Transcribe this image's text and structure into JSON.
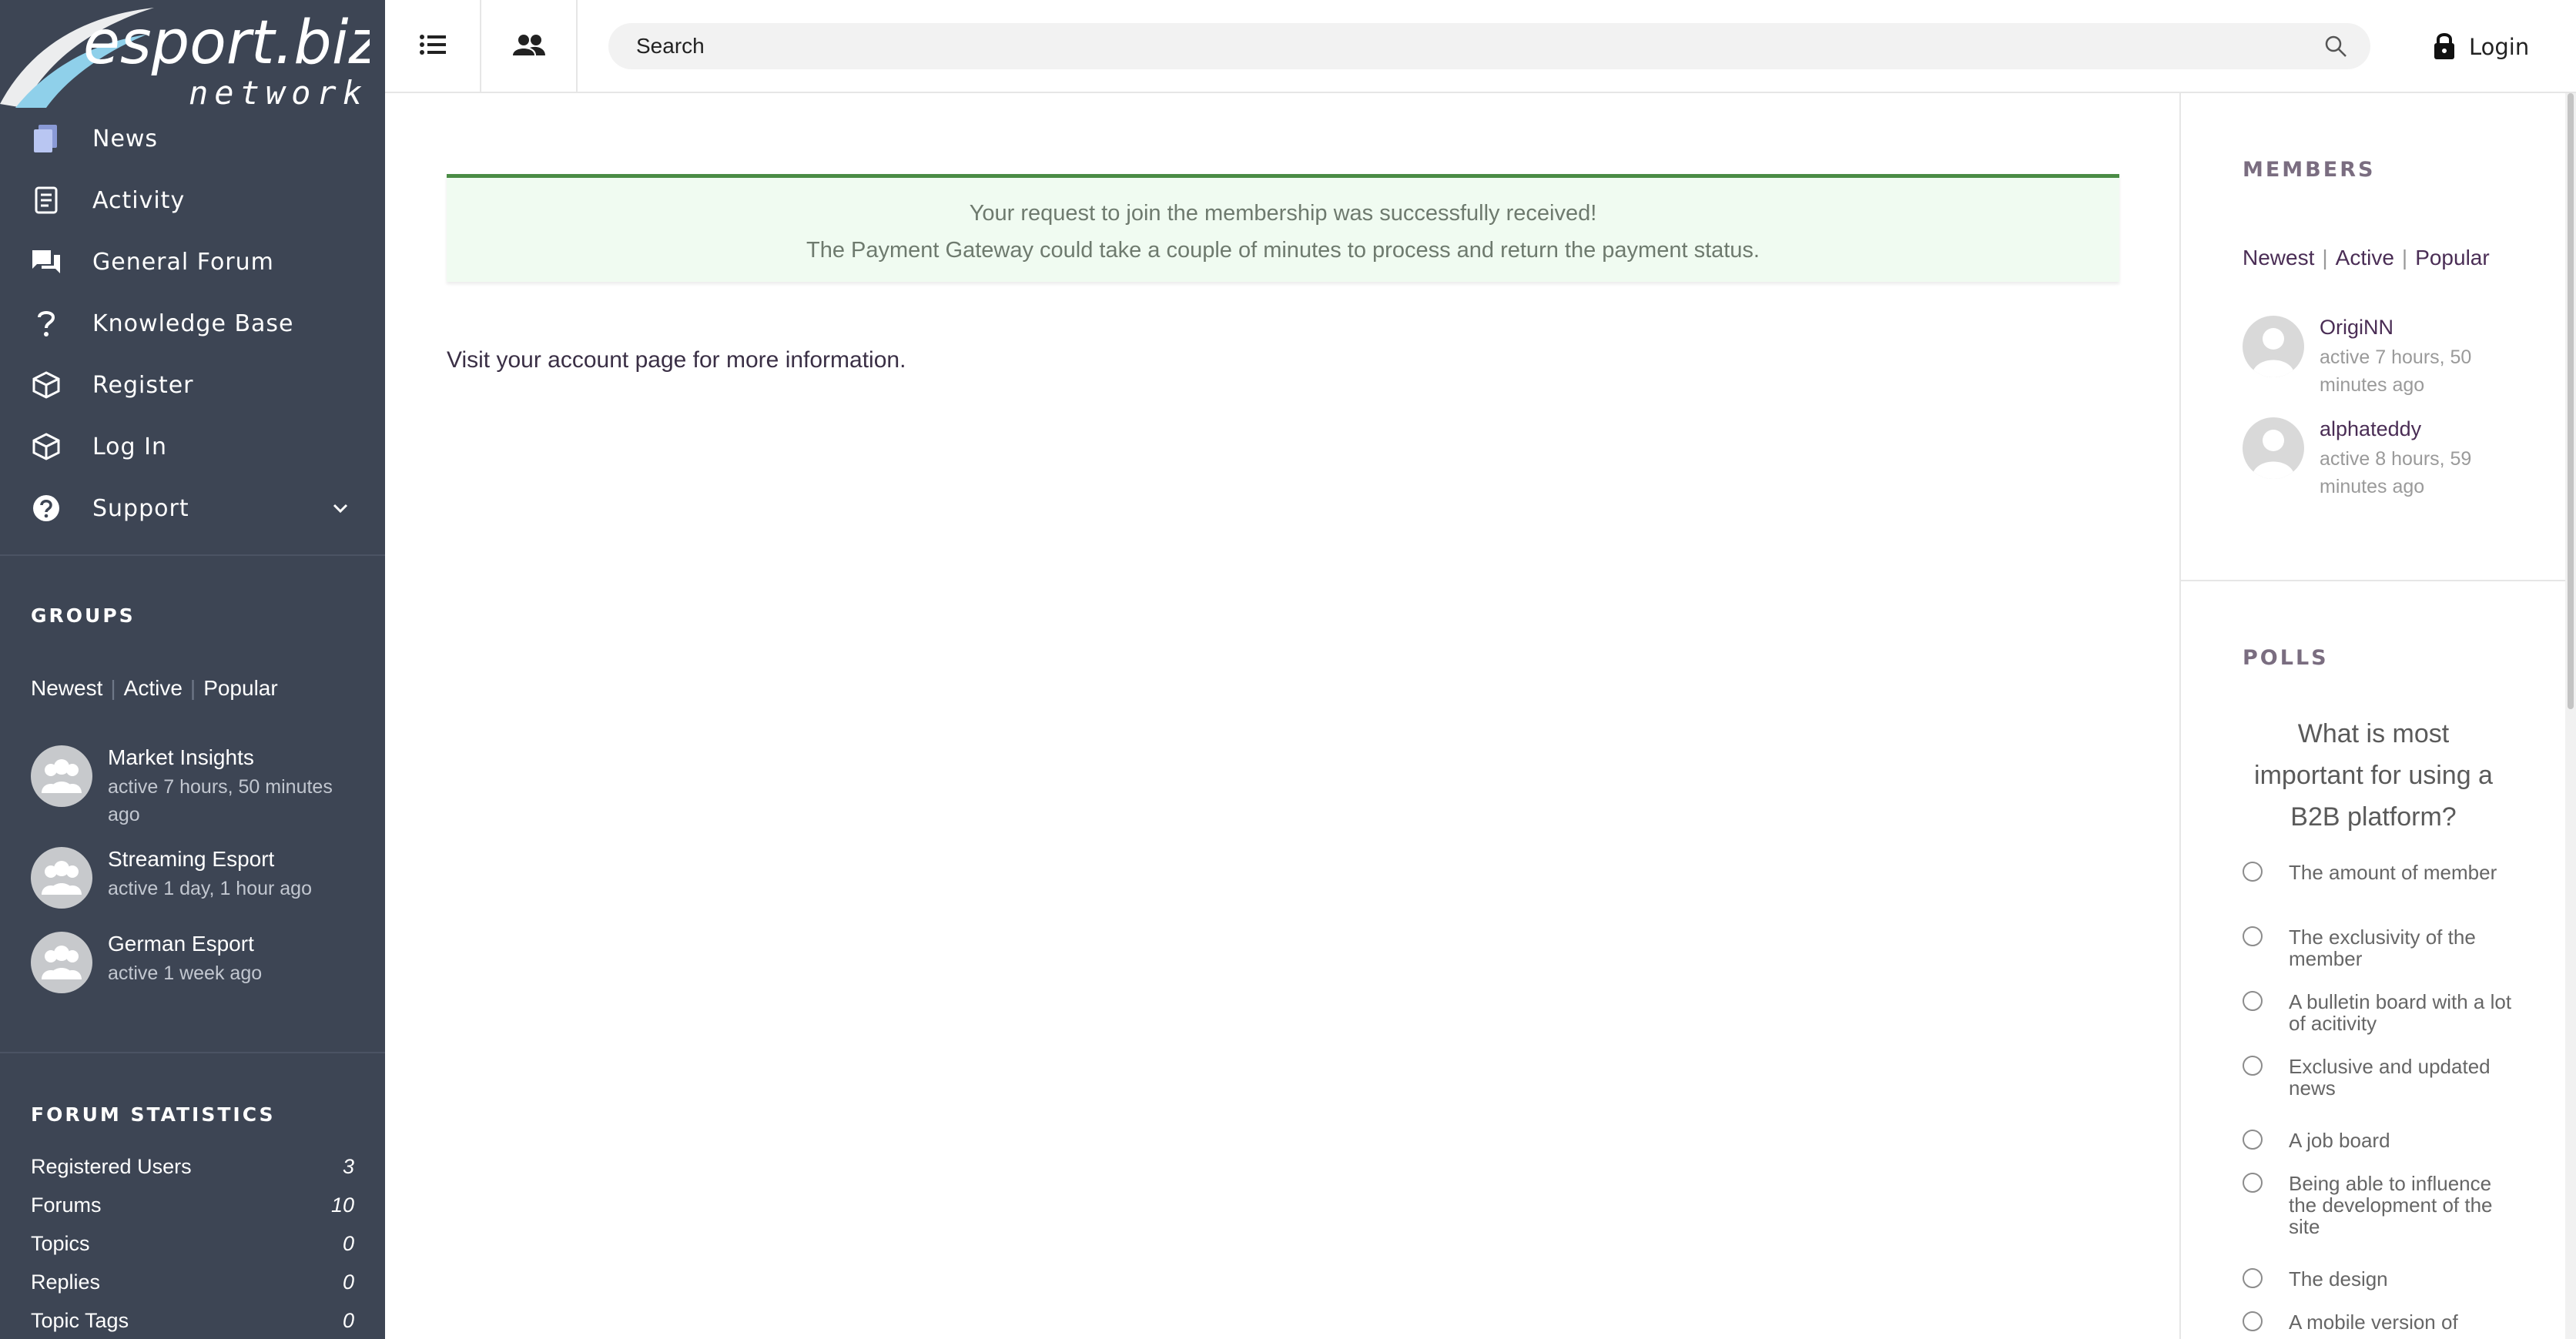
{
  "brand": {
    "logo_text_main": "esport.biz",
    "logo_text_sub": "network"
  },
  "sidebar": {
    "nav": [
      {
        "label": "News",
        "icon": "news-icon"
      },
      {
        "label": "Activity",
        "icon": "activity-icon"
      },
      {
        "label": "General Forum",
        "icon": "forum-icon"
      },
      {
        "label": "Knowledge Base",
        "icon": "question-icon"
      },
      {
        "label": "Register",
        "icon": "cube-icon"
      },
      {
        "label": "Log In",
        "icon": "cube-icon"
      },
      {
        "label": "Support",
        "icon": "help-circle-icon"
      }
    ],
    "groups": {
      "heading": "GROUPS",
      "tabs": [
        "Newest",
        "Active",
        "Popular"
      ],
      "items": [
        {
          "name": "Market Insights",
          "meta": "active 7 hours, 50 minutes ago"
        },
        {
          "name": "Streaming Esport",
          "meta": "active 1 day, 1 hour ago"
        },
        {
          "name": "German Esport",
          "meta": "active 1 week ago"
        }
      ]
    },
    "forum_stats": {
      "heading": "FORUM STATISTICS",
      "rows": [
        {
          "label": "Registered Users",
          "value": "3"
        },
        {
          "label": "Forums",
          "value": "10"
        },
        {
          "label": "Topics",
          "value": "0"
        },
        {
          "label": "Replies",
          "value": "0"
        },
        {
          "label": "Topic Tags",
          "value": "0"
        }
      ]
    }
  },
  "topbar": {
    "search_placeholder": "Search",
    "login_label": "Login"
  },
  "main": {
    "notice_line1": "Your request to join the membership was successfully received!",
    "notice_line2": "The Payment Gateway could take a couple of minutes to process and return the payment status.",
    "info_prefix": "Visit your ",
    "info_link": "account page",
    "info_suffix": " for more information."
  },
  "rightbar": {
    "members": {
      "heading": "MEMBERS",
      "tabs": [
        "Newest",
        "Active",
        "Popular"
      ],
      "items": [
        {
          "name": "OrigiNN",
          "meta": "active 7 hours, 50 minutes ago"
        },
        {
          "name": "alphateddy",
          "meta": "active 8 hours, 59 minutes ago"
        }
      ]
    },
    "polls": {
      "heading": "POLLS",
      "question": "What is most important for using a B2B platform?",
      "options": [
        "The amount of member",
        "The exclusivity of the member",
        "A bulletin board with a lot of acitivity",
        "Exclusive and updated news",
        "A job board",
        "Being able to influence the development of the site",
        "The design",
        "A mobile version of"
      ]
    }
  },
  "colors": {
    "sidebar_bg": "#3d4554",
    "notice_border": "#4a8c45",
    "notice_bg": "#f0fbf1",
    "link_purple": "#4a2d55"
  }
}
